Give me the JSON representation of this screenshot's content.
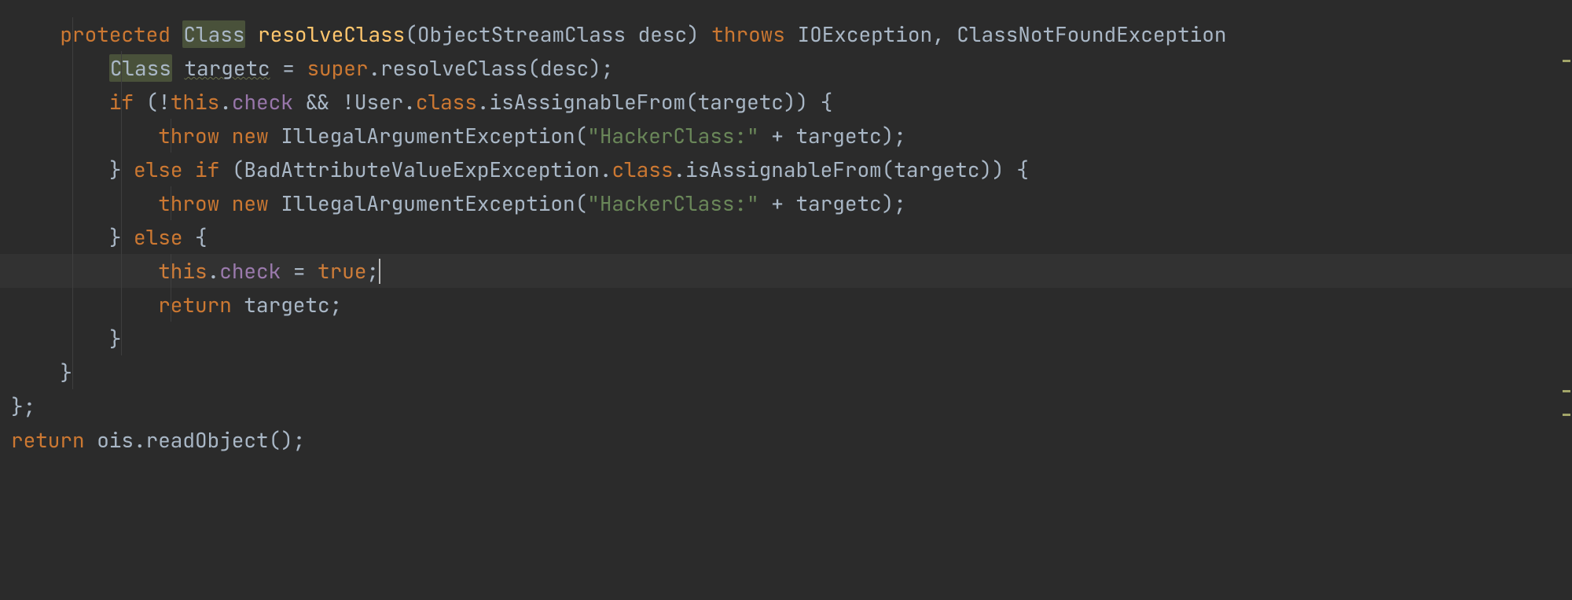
{
  "colors": {
    "background": "#2b2b2b",
    "keyword": "#cc7832",
    "method": "#ffc66d",
    "field": "#9876aa",
    "string": "#6a8759",
    "text": "#a9b7c6",
    "highlight_bg": "#49513a"
  },
  "caret": {
    "line_index": 7,
    "after_text": "this.check = true;"
  },
  "marks": [
    {
      "kind": "warning",
      "top_pct": 10
    },
    {
      "kind": "warning",
      "top_pct": 65
    },
    {
      "kind": "warning",
      "top_pct": 69
    }
  ],
  "code": {
    "lines": [
      {
        "indent": 4,
        "tokens": [
          {
            "t": "protected ",
            "c": "kw"
          },
          {
            "t": "Class",
            "c": "type-hl"
          },
          {
            "t": " ",
            "c": "ident"
          },
          {
            "t": "resolveClass",
            "c": "method-decl"
          },
          {
            "t": "(ObjectStreamClass desc) ",
            "c": "ident"
          },
          {
            "t": "throws ",
            "c": "kw"
          },
          {
            "t": "IOException",
            "c": "ident"
          },
          {
            "t": ", ",
            "c": "punct"
          },
          {
            "t": "ClassNotFoundException",
            "c": "ident"
          }
        ]
      },
      {
        "indent": 8,
        "tokens": [
          {
            "t": "Class",
            "c": "type-hl"
          },
          {
            "t": " ",
            "c": "ident"
          },
          {
            "t": "targetc",
            "c": "ident warn-under"
          },
          {
            "t": " = ",
            "c": "op"
          },
          {
            "t": "super",
            "c": "kw"
          },
          {
            "t": ".resolveClass(desc);",
            "c": "ident"
          }
        ]
      },
      {
        "indent": 8,
        "tokens": [
          {
            "t": "if ",
            "c": "kw"
          },
          {
            "t": "(!",
            "c": "punct"
          },
          {
            "t": "this",
            "c": "kw"
          },
          {
            "t": ".",
            "c": "punct"
          },
          {
            "t": "check",
            "c": "field"
          },
          {
            "t": " && !User.",
            "c": "ident"
          },
          {
            "t": "class",
            "c": "kw"
          },
          {
            "t": ".isAssignableFrom(targetc)) {",
            "c": "ident"
          }
        ]
      },
      {
        "indent": 12,
        "tokens": [
          {
            "t": "throw new ",
            "c": "kw"
          },
          {
            "t": "IllegalArgumentException(",
            "c": "ident"
          },
          {
            "t": "\"HackerClass:\"",
            "c": "str"
          },
          {
            "t": " + targetc);",
            "c": "ident"
          }
        ]
      },
      {
        "indent": 8,
        "tokens": [
          {
            "t": "} ",
            "c": "punct"
          },
          {
            "t": "else if ",
            "c": "kw"
          },
          {
            "t": "(BadAttributeValueExpException.",
            "c": "ident"
          },
          {
            "t": "class",
            "c": "kw"
          },
          {
            "t": ".isAssignableFrom(targetc)) {",
            "c": "ident"
          }
        ]
      },
      {
        "indent": 12,
        "tokens": [
          {
            "t": "throw new ",
            "c": "kw"
          },
          {
            "t": "IllegalArgumentException(",
            "c": "ident"
          },
          {
            "t": "\"HackerClass:\"",
            "c": "str"
          },
          {
            "t": " + targetc);",
            "c": "ident"
          }
        ]
      },
      {
        "indent": 8,
        "tokens": [
          {
            "t": "} ",
            "c": "punct"
          },
          {
            "t": "else ",
            "c": "kw"
          },
          {
            "t": "{",
            "c": "punct"
          }
        ]
      },
      {
        "indent": 12,
        "highlight": true,
        "tokens": [
          {
            "t": "this",
            "c": "kw"
          },
          {
            "t": ".",
            "c": "punct"
          },
          {
            "t": "check",
            "c": "field"
          },
          {
            "t": " = ",
            "c": "op"
          },
          {
            "t": "true",
            "c": "kw"
          },
          {
            "t": ";",
            "c": "punct"
          }
        ]
      },
      {
        "indent": 12,
        "tokens": [
          {
            "t": "return ",
            "c": "kw"
          },
          {
            "t": "targetc;",
            "c": "ident"
          }
        ]
      },
      {
        "indent": 8,
        "tokens": [
          {
            "t": "}",
            "c": "punct"
          }
        ]
      },
      {
        "indent": 4,
        "tokens": [
          {
            "t": "}",
            "c": "punct"
          }
        ]
      },
      {
        "indent": 0,
        "tokens": [
          {
            "t": "};",
            "c": "punct"
          }
        ]
      },
      {
        "indent": 0,
        "tokens": [
          {
            "t": "return ",
            "c": "kw"
          },
          {
            "t": "ois.readObject();",
            "c": "ident"
          }
        ]
      }
    ]
  }
}
